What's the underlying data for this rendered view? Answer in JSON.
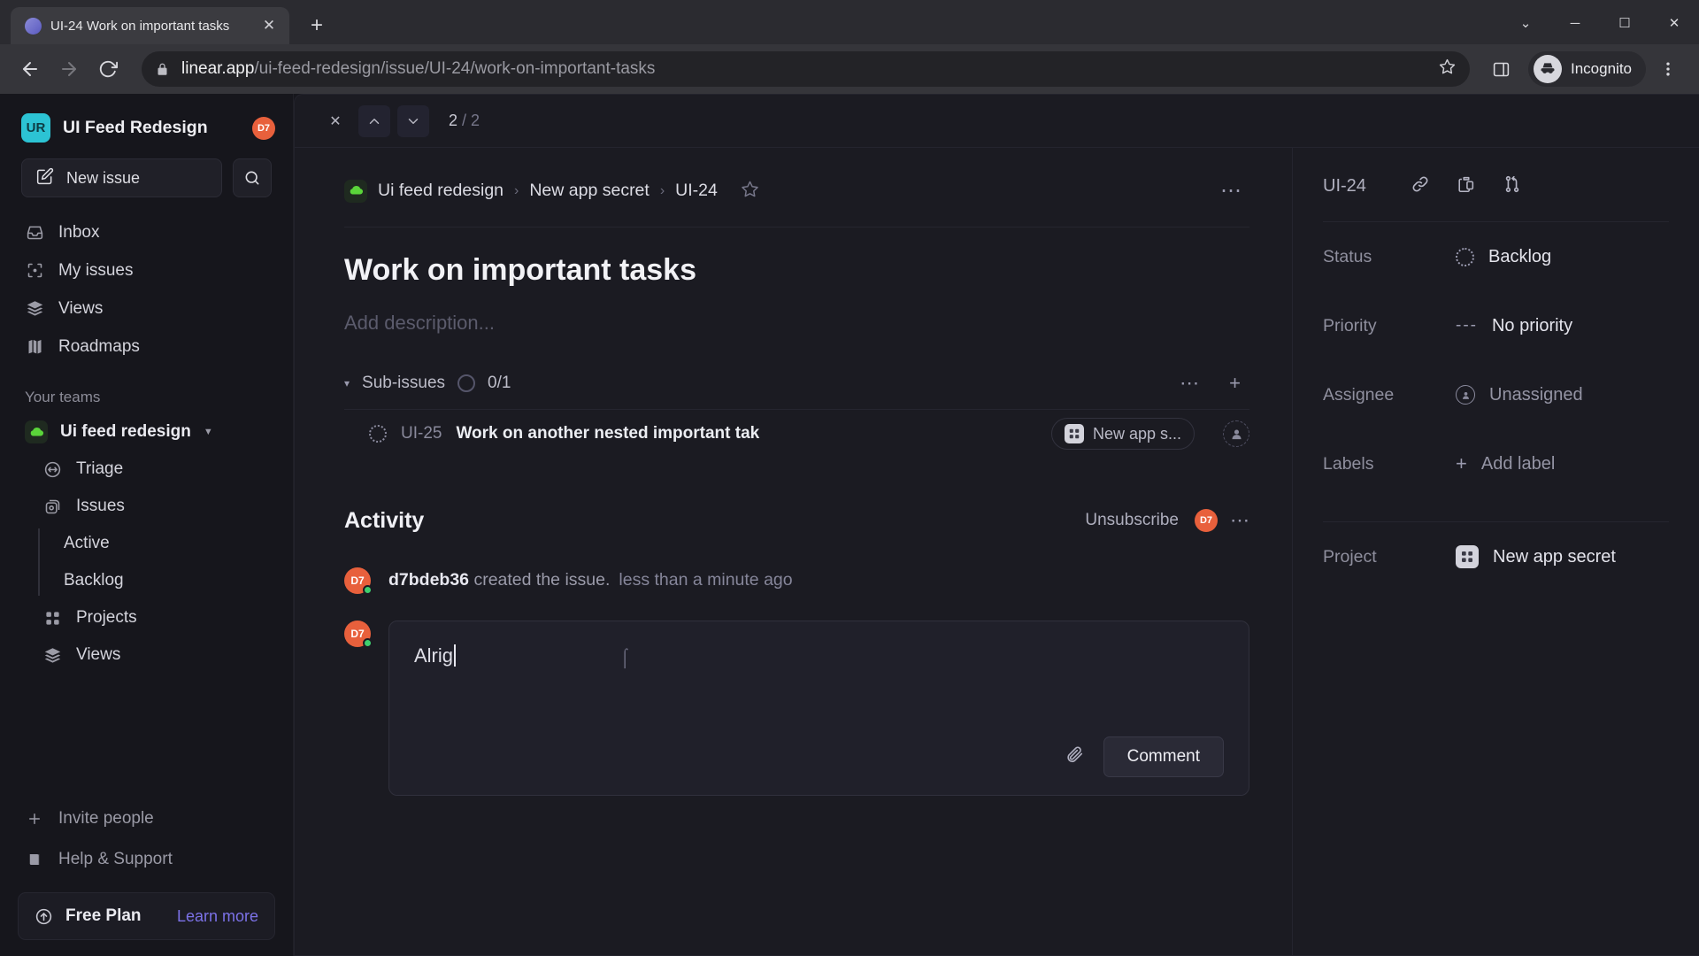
{
  "browser": {
    "tab_title": "UI-24 Work on important tasks",
    "tab_favicon": "linear-logo-icon",
    "new_tab_label": "+",
    "close_tab_label": "✕",
    "url_domain": "linear.app",
    "url_path": "/ui-feed-redesign/issue/UI-24/work-on-important-tasks",
    "profile_label": "Incognito",
    "window_minimize": "─",
    "window_maximize": "☐",
    "window_close": "✕",
    "window_more": "⌄"
  },
  "sidebar": {
    "workspace_initials": "UR",
    "workspace_name": "UI Feed Redesign",
    "workspace_avatar": "D7",
    "new_issue_label": "New issue",
    "nav": [
      {
        "label": "Inbox",
        "icon": "inbox-icon"
      },
      {
        "label": "My issues",
        "icon": "my-issues-icon"
      },
      {
        "label": "Views",
        "icon": "views-icon"
      },
      {
        "label": "Roadmaps",
        "icon": "roadmaps-icon"
      }
    ],
    "teams_label": "Your teams",
    "team_name": "Ui feed redesign",
    "team_items": [
      {
        "label": "Triage",
        "icon": "triage-icon"
      },
      {
        "label": "Issues",
        "icon": "issues-icon"
      }
    ],
    "issue_children": [
      "Active",
      "Backlog"
    ],
    "team_items_2": [
      {
        "label": "Projects",
        "icon": "projects-icon"
      },
      {
        "label": "Views",
        "icon": "views-icon"
      }
    ],
    "footer": [
      {
        "label": "Invite people",
        "icon": "plus-icon"
      },
      {
        "label": "Help & Support",
        "icon": "book-icon"
      }
    ],
    "plan_name": "Free Plan",
    "plan_link": "Learn more"
  },
  "peekbar": {
    "close_label": "✕",
    "prev_label": "prev-issue",
    "next_label": "next-issue",
    "position": "2",
    "separator": " / ",
    "total": "2"
  },
  "issue": {
    "breadcrumb": [
      "Ui feed redesign",
      "New app secret",
      "UI-24"
    ],
    "breadcrumb_sep": "›",
    "title": "Work on important tasks",
    "description_placeholder": "Add description...",
    "subissues": {
      "caret": "▾",
      "label": "Sub-issues",
      "count": "0/1",
      "rows": [
        {
          "id": "UI-25",
          "name": "Work on another nested important tak",
          "project_chip": "New app s...",
          "assignee": "unassigned"
        }
      ]
    },
    "activity": {
      "title": "Activity",
      "unsubscribe_label": "Unsubscribe",
      "watcher_avatar": "D7",
      "entries": [
        {
          "avatar": "D7",
          "author": "d7bdeb36",
          "action": "created the issue.",
          "time": "less than a minute ago"
        }
      ],
      "composer": {
        "avatar": "D7",
        "value": "Alrig",
        "submit_label": "Comment",
        "attach_icon": "paperclip-icon"
      }
    }
  },
  "properties": {
    "id": "UI-24",
    "icons": [
      "link-icon",
      "copy-icon",
      "branch-icon"
    ],
    "rows": [
      {
        "label": "Status",
        "value": "Backlog",
        "icon": "backlog-circle-icon"
      },
      {
        "label": "Priority",
        "value": "No priority",
        "icon": "no-priority-icon"
      },
      {
        "label": "Assignee",
        "value": "Unassigned",
        "icon": "person-circle-icon"
      },
      {
        "label": "Labels",
        "value": "Add label",
        "icon": "plus-icon"
      }
    ],
    "project_label": "Project",
    "project_value": "New app secret"
  },
  "colors": {
    "accent": "#7c72e8",
    "avatar": "#e8603c",
    "workspace_logo": "#2cc3d4",
    "online": "#3ecf6e",
    "team_green": "#5ad43a"
  }
}
